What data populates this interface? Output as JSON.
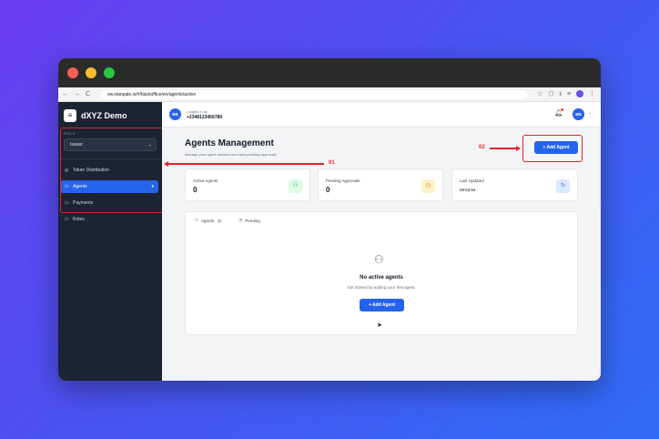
{
  "browser": {
    "url": "sw.stanpale.io/#/backoffice/en/agents/active",
    "nav_icons": [
      "←",
      "→",
      "C"
    ],
    "tool_icons": [
      "☆",
      "⬡",
      "⭳",
      "≡",
      "⋮"
    ]
  },
  "sidebar": {
    "brand": "dXYZ Demo",
    "role_label": "ROLE",
    "role_value": "Issuer",
    "items": [
      {
        "label": "Token Distribution",
        "icon": "◎"
      },
      {
        "label": "Agents",
        "icon": "⚇",
        "caret": "▾"
      },
      {
        "label": "Payments",
        "icon": "▭"
      },
      {
        "label": "Roles",
        "icon": "⚇"
      }
    ]
  },
  "topbar": {
    "avatar": "BB",
    "login_label": "Logged in as",
    "phone": "+2348123456789",
    "profile_avatar": "BB"
  },
  "page": {
    "title": "Agents Management",
    "subtitle": "Manage your agent network and track pending approvals",
    "add_button": "+ Add Agent"
  },
  "stats": [
    {
      "label": "Active Agents",
      "value": "0",
      "icon": "⚇",
      "color": "#dcfce7",
      "icon_color": "#16a34a"
    },
    {
      "label": "Pending Approvals",
      "value": "0",
      "icon": "◷",
      "color": "#fef3c7",
      "icon_color": "#d97706"
    },
    {
      "label": "Last Updated",
      "value": "09:53:54",
      "icon": "↻",
      "color": "#dbeafe",
      "icon_color": "#2563eb"
    }
  ],
  "tabs": [
    {
      "label": "Agents",
      "badge": "0",
      "icon": "⚇"
    },
    {
      "label": "Pending",
      "icon": "◷"
    }
  ],
  "empty": {
    "icon": "⚇",
    "title": "No active agents",
    "subtitle": "Get started by adding your first agent.",
    "button": "+ Add Agent"
  },
  "annotations": {
    "left_number": "01",
    "right_number": "02",
    "color": "#e3242b"
  }
}
